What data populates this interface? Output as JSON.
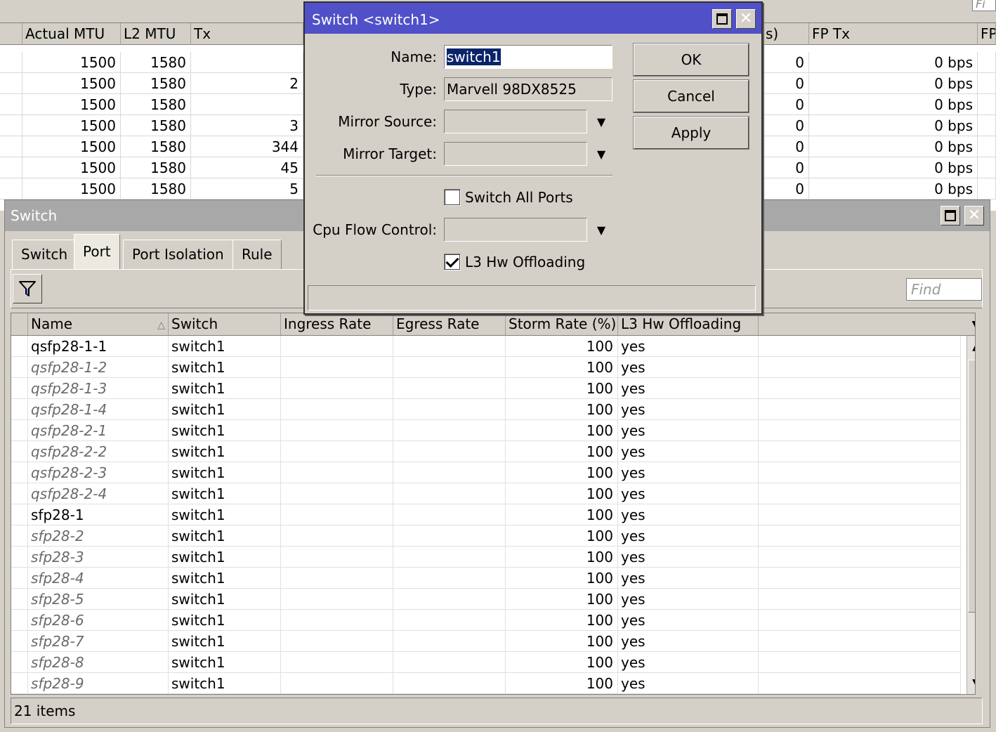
{
  "background_table": {
    "find_stub": "Fi",
    "columns": [
      "Actual MTU",
      "L2 MTU",
      "Tx",
      "s)",
      "FP Tx",
      "FP"
    ],
    "rows": [
      {
        "actual_mtu": "1500",
        "l2_mtu": "1580",
        "tx": "",
        "fp_rx_pkts": "0",
        "fp_tx": "0 bps"
      },
      {
        "actual_mtu": "1500",
        "l2_mtu": "1580",
        "tx": "2",
        "fp_rx_pkts": "0",
        "fp_tx": "0 bps"
      },
      {
        "actual_mtu": "1500",
        "l2_mtu": "1580",
        "tx": "",
        "fp_rx_pkts": "0",
        "fp_tx": "0 bps"
      },
      {
        "actual_mtu": "1500",
        "l2_mtu": "1580",
        "tx": "3",
        "fp_rx_pkts": "0",
        "fp_tx": "0 bps"
      },
      {
        "actual_mtu": "1500",
        "l2_mtu": "1580",
        "tx": "344",
        "fp_rx_pkts": "0",
        "fp_tx": "0 bps"
      },
      {
        "actual_mtu": "1500",
        "l2_mtu": "1580",
        "tx": "45",
        "fp_rx_pkts": "0",
        "fp_tx": "0 bps"
      },
      {
        "actual_mtu": "1500",
        "l2_mtu": "1580",
        "tx": "5",
        "fp_rx_pkts": "0",
        "fp_tx": "0 bps"
      }
    ]
  },
  "switch_window": {
    "title": "Switch",
    "tabs": [
      {
        "label": "Switch",
        "active": false
      },
      {
        "label": "Port",
        "active": true
      },
      {
        "label": "Port Isolation",
        "active": false
      },
      {
        "label": "Rule",
        "active": false
      }
    ],
    "find_placeholder": "Find",
    "columns": [
      "Name",
      "Switch",
      "Ingress Rate",
      "Egress Rate",
      "Storm Rate (%)",
      "L3 Hw Offloading"
    ],
    "rows": [
      {
        "name": "qsfp28-1-1",
        "switch": "switch1",
        "ingress": "",
        "egress": "",
        "storm": "100",
        "l3": "yes",
        "active": true
      },
      {
        "name": "qsfp28-1-2",
        "switch": "switch1",
        "ingress": "",
        "egress": "",
        "storm": "100",
        "l3": "yes",
        "active": false
      },
      {
        "name": "qsfp28-1-3",
        "switch": "switch1",
        "ingress": "",
        "egress": "",
        "storm": "100",
        "l3": "yes",
        "active": false
      },
      {
        "name": "qsfp28-1-4",
        "switch": "switch1",
        "ingress": "",
        "egress": "",
        "storm": "100",
        "l3": "yes",
        "active": false
      },
      {
        "name": "qsfp28-2-1",
        "switch": "switch1",
        "ingress": "",
        "egress": "",
        "storm": "100",
        "l3": "yes",
        "active": false
      },
      {
        "name": "qsfp28-2-2",
        "switch": "switch1",
        "ingress": "",
        "egress": "",
        "storm": "100",
        "l3": "yes",
        "active": false
      },
      {
        "name": "qsfp28-2-3",
        "switch": "switch1",
        "ingress": "",
        "egress": "",
        "storm": "100",
        "l3": "yes",
        "active": false
      },
      {
        "name": "qsfp28-2-4",
        "switch": "switch1",
        "ingress": "",
        "egress": "",
        "storm": "100",
        "l3": "yes",
        "active": false
      },
      {
        "name": "sfp28-1",
        "switch": "switch1",
        "ingress": "",
        "egress": "",
        "storm": "100",
        "l3": "yes",
        "active": true
      },
      {
        "name": "sfp28-2",
        "switch": "switch1",
        "ingress": "",
        "egress": "",
        "storm": "100",
        "l3": "yes",
        "active": false
      },
      {
        "name": "sfp28-3",
        "switch": "switch1",
        "ingress": "",
        "egress": "",
        "storm": "100",
        "l3": "yes",
        "active": false
      },
      {
        "name": "sfp28-4",
        "switch": "switch1",
        "ingress": "",
        "egress": "",
        "storm": "100",
        "l3": "yes",
        "active": false
      },
      {
        "name": "sfp28-5",
        "switch": "switch1",
        "ingress": "",
        "egress": "",
        "storm": "100",
        "l3": "yes",
        "active": false
      },
      {
        "name": "sfp28-6",
        "switch": "switch1",
        "ingress": "",
        "egress": "",
        "storm": "100",
        "l3": "yes",
        "active": false
      },
      {
        "name": "sfp28-7",
        "switch": "switch1",
        "ingress": "",
        "egress": "",
        "storm": "100",
        "l3": "yes",
        "active": false
      },
      {
        "name": "sfp28-8",
        "switch": "switch1",
        "ingress": "",
        "egress": "",
        "storm": "100",
        "l3": "yes",
        "active": false
      },
      {
        "name": "sfp28-9",
        "switch": "switch1",
        "ingress": "",
        "egress": "",
        "storm": "100",
        "l3": "yes",
        "active": false
      }
    ],
    "status": "21 items"
  },
  "dialog": {
    "title": "Switch <switch1>",
    "name_label": "Name:",
    "name_value": "switch1",
    "type_label": "Type:",
    "type_value": "Marvell 98DX8525",
    "mirror_source_label": "Mirror Source:",
    "mirror_source_value": "",
    "mirror_target_label": "Mirror Target:",
    "mirror_target_value": "",
    "switch_all_ports_label": "Switch All Ports",
    "switch_all_ports_checked": false,
    "cpu_flow_control_label": "Cpu Flow Control:",
    "cpu_flow_control_value": "",
    "l3_hw_offloading_label": "L3 Hw Offloading",
    "l3_hw_offloading_checked": true,
    "ok_label": "OK",
    "cancel_label": "Cancel",
    "apply_label": "Apply"
  },
  "icons": {
    "filter": "filter-icon",
    "maximize": "maximize-icon",
    "close": "close-icon",
    "dropdown": "dropdown-arrow-icon",
    "sort": "sort-ascending-icon",
    "scroll_up": "scroll-up-icon",
    "scroll_down": "scroll-down-icon"
  },
  "colors": {
    "dialog_title_bg": "#5050c8",
    "window_title_bg": "#a8a8a8",
    "selection_bg": "#0a246a",
    "inactive_text": "#6a6a6a"
  }
}
